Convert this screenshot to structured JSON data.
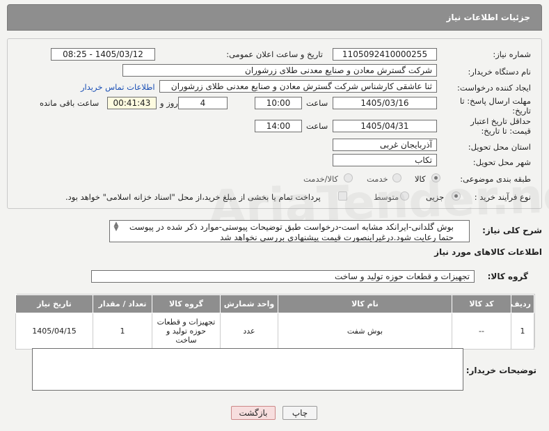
{
  "header": {
    "title": "جزئیات اطلاعات نیاز"
  },
  "labels": {
    "need_number": "شماره نیاز:",
    "announce_datetime": "تاریخ و ساعت اعلان عمومی:",
    "buyer_org": "نام دستگاه خریدار:",
    "requester": "ایجاد کننده درخواست:",
    "reply_deadline": "مهلت ارسال پاسخ: تا تاریخ:",
    "hour": "ساعت",
    "day_and": "روز و",
    "remaining": "ساعت باقی مانده",
    "price_validity": "حداقل تاریخ اعتبار قیمت: تا تاریخ:",
    "province": "استان محل تحویل:",
    "city": "شهر محل تحویل:",
    "category": "طبقه بندی موضوعی:",
    "purchase_type": "نوع فرآیند خرید :",
    "general_desc": "شرح کلی نیاز:",
    "goods_info": "اطلاعات کالاهای مورد نیاز",
    "goods_group": "گروه کالا:",
    "buyer_notes": "توضیحات خریدار:"
  },
  "fields": {
    "need_number": "1105092410000255",
    "announce_datetime": "1405/03/12 - 08:25",
    "buyer_org": "شرکت گسترش معادن و صنایع معدنی طلای زرشوران",
    "requester": "ثنا عاشقی کارشناس شرکت گسترش معادن و صنایع معدنی طلای زرشوران",
    "contact_link": "اطلاعات تماس خریدار",
    "reply_date": "1405/03/16",
    "reply_time": "10:00",
    "reply_days": "4",
    "reply_remaining": "00:41:43",
    "validity_date": "1405/04/31",
    "validity_time": "14:00",
    "province": "آذربایجان غربی",
    "city": "تکاب",
    "goods_group": "تجهیزات و قطعات حوزه تولید و ساخت",
    "general_desc": "بوش گلدانی-ایرانکد مشابه است-درخواست طبق توضیحات پیوستی-موارد ذکر شده در پیوست حتما رعایت شود.درغیراینصورت قیمت پیشنهادی بررسی نخواهد شد",
    "buyer_notes": ""
  },
  "category_options": [
    {
      "label": "کالا",
      "selected": true
    },
    {
      "label": "خدمت",
      "selected": false
    },
    {
      "label": "کالا/خدمت",
      "selected": false
    }
  ],
  "purchase_options": [
    {
      "label": "جزیی",
      "selected": true
    },
    {
      "label": "متوسط",
      "selected": false
    }
  ],
  "payment_note": "پرداخت تمام یا بخشی از مبلغ خرید،از محل \"اسناد خزانه اسلامی\" خواهد بود.",
  "table": {
    "headers": [
      "ردیف",
      "کد کالا",
      "نام کالا",
      "واحد شمارش",
      "گروه کالا",
      "تعداد / مقدار",
      "تاریخ نیاز"
    ],
    "rows": [
      [
        "1",
        "--",
        "بوش شفت",
        "عدد",
        "تجهیزات و قطعات حوزه تولید و ساخت",
        "1",
        "1405/04/15"
      ]
    ]
  },
  "buttons": {
    "print": "چاپ",
    "back": "بازگشت"
  },
  "watermark": "AriaTender.net"
}
